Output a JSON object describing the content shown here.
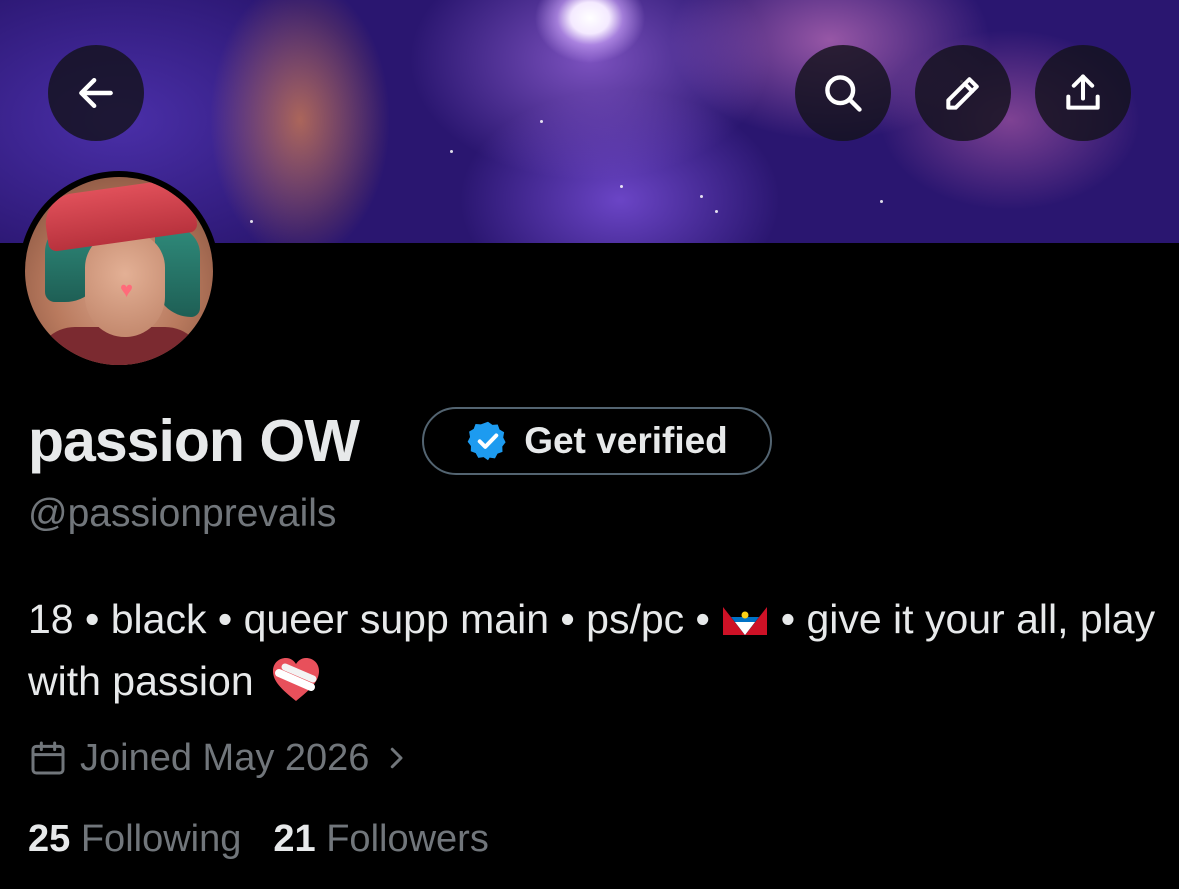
{
  "header": {
    "back_icon": "arrow-left-icon",
    "search_icon": "search-icon",
    "edit_icon": "pencil-icon",
    "share_icon": "share-upload-icon"
  },
  "profile": {
    "name": "passion OW",
    "verify_label": "Get verified",
    "handle": "@passionprevails",
    "bio_part1": "18 • black • queer supp main • ps/pc •",
    "bio_part2": "• give it your all, play with passion",
    "joined": "Joined May 2026",
    "following_count": "25",
    "following_label": "Following",
    "followers_count": "21",
    "followers_label": "Followers"
  },
  "colors": {
    "background": "#000000",
    "primary_text": "#e7e9ea",
    "secondary_text": "#71767b",
    "verified_blue": "#1d9bf0"
  }
}
